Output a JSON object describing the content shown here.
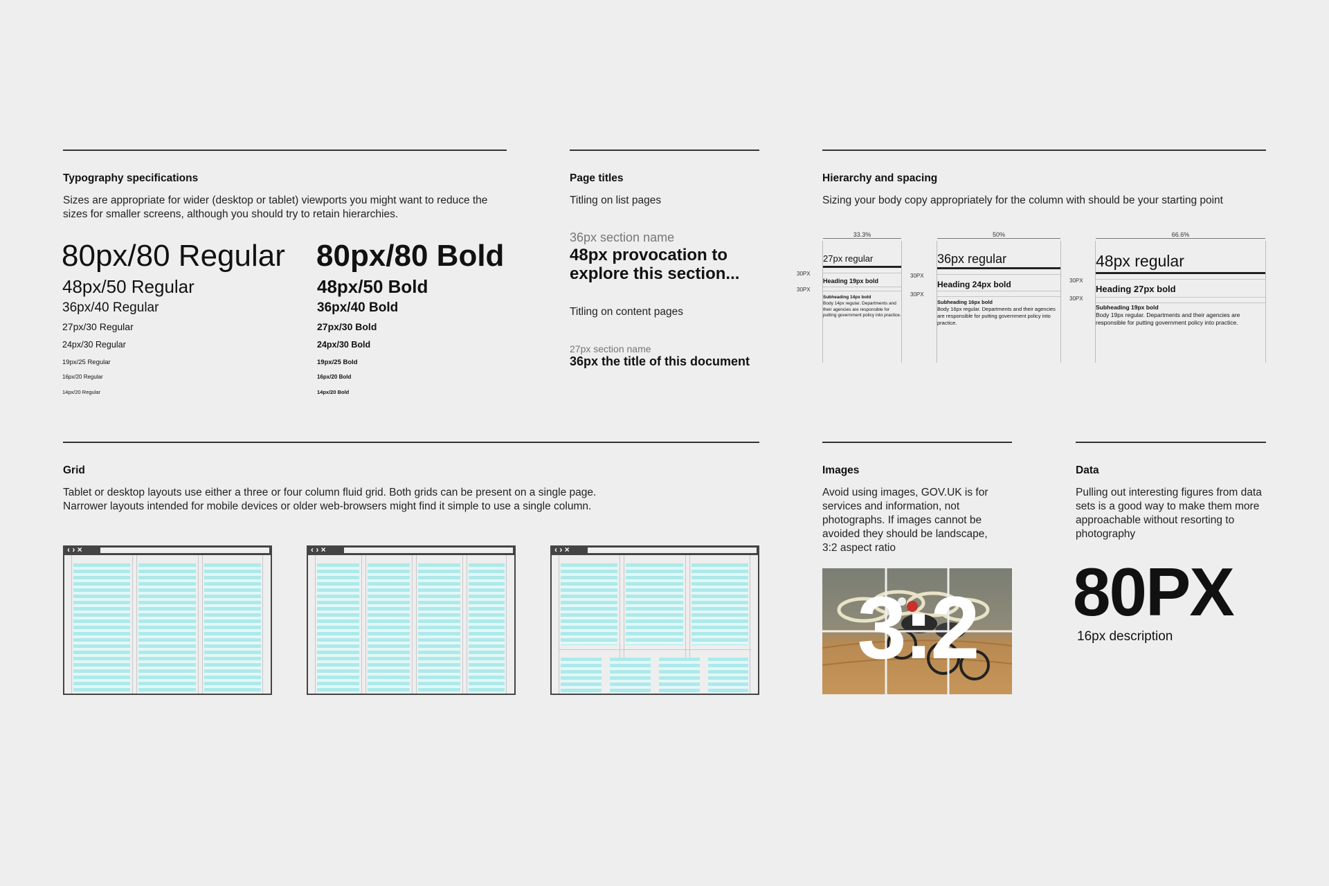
{
  "typography": {
    "title": "Typography specifications",
    "desc": "Sizes are appropriate for wider (desktop or tablet) viewports you might want to reduce the sizes for smaller screens, although you should try to retain hierarchies.",
    "regular": [
      "80px/80 Regular",
      "48px/50 Regular",
      "36px/40 Regular",
      "27px/30 Regular",
      "24px/30 Regular",
      "19px/25 Regular",
      "16px/20 Regular",
      "14px/20 Regular"
    ],
    "bold": [
      "80px/80 Bold",
      "48px/50 Bold",
      "36px/40 Bold",
      "27px/30 Bold",
      "24px/30 Bold",
      "19px/25 Bold",
      "16px/20 Bold",
      "14px/20 Bold"
    ]
  },
  "page_titles": {
    "title": "Page titles",
    "list_label": "Titling on list pages",
    "list_section": "36px section name",
    "list_heading": "48px provocation to explore this section...",
    "content_label": "Titling on content pages",
    "content_section": "27px section name",
    "content_heading": "36px the title of this document"
  },
  "hierarchy": {
    "title": "Hierarchy and spacing",
    "desc": "Sizing your body copy appropriately for the column with should be your starting point",
    "spacing_label": "30PX",
    "columns": [
      {
        "pct": "33.3%",
        "main": "27px regular",
        "heading": "Heading 19px bold",
        "sub": "Subheading 14px bold",
        "body": "Body 14px regular. Departments and their agencies are responsible for putting government policy into practice."
      },
      {
        "pct": "50%",
        "main": "36px regular",
        "heading": "Heading 24px bold",
        "sub": "Subheading 16px bold",
        "body": "Body 16px regular. Departments and their agencies are responsible for putting government policy into practice."
      },
      {
        "pct": "66.6%",
        "main": "48px regular",
        "heading": "Heading 27px bold",
        "sub": "Subheading 19px bold",
        "body": "Body 19px regular. Departments and their agencies are responsible for putting government policy into practice."
      }
    ]
  },
  "grid": {
    "title": "Grid",
    "desc_line1": "Tablet or desktop layouts use either a three or four column fluid grid. Both grids can be present on a single page.",
    "desc_line2": "Narrower layouts intended for mobile devices or older web-browsers might find it simple to use a single column.",
    "browser_controls": "‹ › ×"
  },
  "images": {
    "title": "Images",
    "desc": "Avoid using images, GOV.UK is for services and information, not photographs. If images cannot be avoided they should be landscape, 3:2 aspect ratio",
    "ratio": "3:2"
  },
  "data": {
    "title": "Data",
    "desc": "Pulling out interesting figures from data sets is a good way to make them more approachable without resorting to photography",
    "big": "80PX",
    "caption": "16px description"
  },
  "colors": {
    "background": "#eeeeee",
    "rule": "#333333",
    "grid_stripe": "#aee9ea",
    "grey_text": "#767676"
  }
}
